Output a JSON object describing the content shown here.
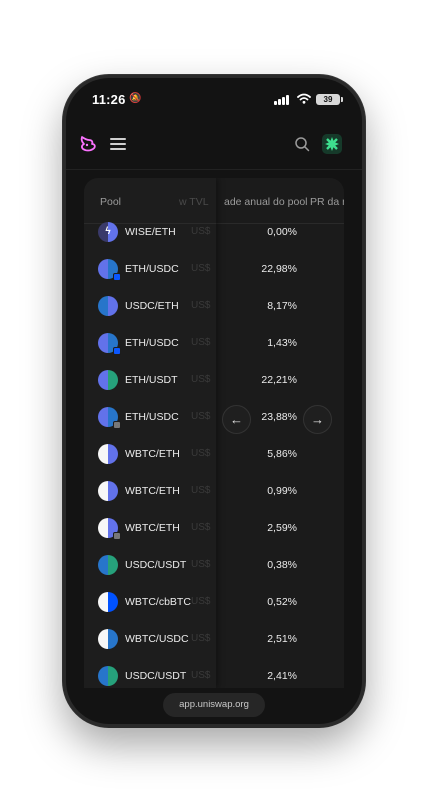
{
  "status_bar": {
    "time": "11:26",
    "battery": "39"
  },
  "browser": {
    "url": "app.uniswap.org"
  },
  "table": {
    "headers": {
      "pool": "Pool",
      "tvl": "w TVL",
      "apr": "ade anual do pool",
      "apr2": "PR da r"
    },
    "rows": [
      {
        "pair": "WISE/ETH",
        "tvl": "US$",
        "apr": "0,00%",
        "left": "#3a3a6a",
        "right": "#6272ea",
        "glyph": "ϟ",
        "chain": ""
      },
      {
        "pair": "ETH/USDC",
        "tvl": "US$",
        "apr": "22,98%",
        "left": "#6272ea",
        "right": "#2775ca",
        "glyph": "",
        "chain": "blue"
      },
      {
        "pair": "USDC/ETH",
        "tvl": "US$",
        "apr": "8,17%",
        "left": "#2775ca",
        "right": "#6272ea",
        "glyph": "",
        "chain": ""
      },
      {
        "pair": "ETH/USDC",
        "tvl": "US$",
        "apr": "1,43%",
        "left": "#6272ea",
        "right": "#2775ca",
        "glyph": "",
        "chain": "blue"
      },
      {
        "pair": "ETH/USDT",
        "tvl": "US$",
        "apr": "22,21%",
        "left": "#6272ea",
        "right": "#26a17b",
        "glyph": "",
        "chain": ""
      },
      {
        "pair": "ETH/USDC",
        "tvl": "US$",
        "apr": "23,88%",
        "left": "#6272ea",
        "right": "#2775ca",
        "glyph": "",
        "chain": "grey"
      },
      {
        "pair": "WBTC/ETH",
        "tvl": "US$",
        "apr": "5,86%",
        "left": "#f7f7f7",
        "right": "#6272ea",
        "glyph": "",
        "chain": ""
      },
      {
        "pair": "WBTC/ETH",
        "tvl": "US$",
        "apr": "0,99%",
        "left": "#f7f7f7",
        "right": "#6272ea",
        "glyph": "",
        "chain": ""
      },
      {
        "pair": "WBTC/ETH",
        "tvl": "US$",
        "apr": "2,59%",
        "left": "#f7f7f7",
        "right": "#6272ea",
        "glyph": "",
        "chain": "grey"
      },
      {
        "pair": "USDC/USDT",
        "tvl": "US$",
        "apr": "0,38%",
        "left": "#2775ca",
        "right": "#26a17b",
        "glyph": "",
        "chain": ""
      },
      {
        "pair": "WBTC/cbBTC",
        "tvl": "US$",
        "apr": "0,52%",
        "left": "#f7f7f7",
        "right": "#0052ff",
        "glyph": "",
        "chain": ""
      },
      {
        "pair": "WBTC/USDC",
        "tvl": "US$",
        "apr": "2,51%",
        "left": "#f7f7f7",
        "right": "#2775ca",
        "glyph": "",
        "chain": ""
      },
      {
        "pair": "USDC/USDT",
        "tvl": "US$",
        "apr": "2,41%",
        "left": "#2775ca",
        "right": "#26a17b",
        "glyph": "",
        "chain": ""
      }
    ]
  },
  "nav": {
    "scroll_left": "←",
    "scroll_right": "→"
  },
  "colors": {
    "accent": "#fc72ff",
    "background": "#131313"
  }
}
